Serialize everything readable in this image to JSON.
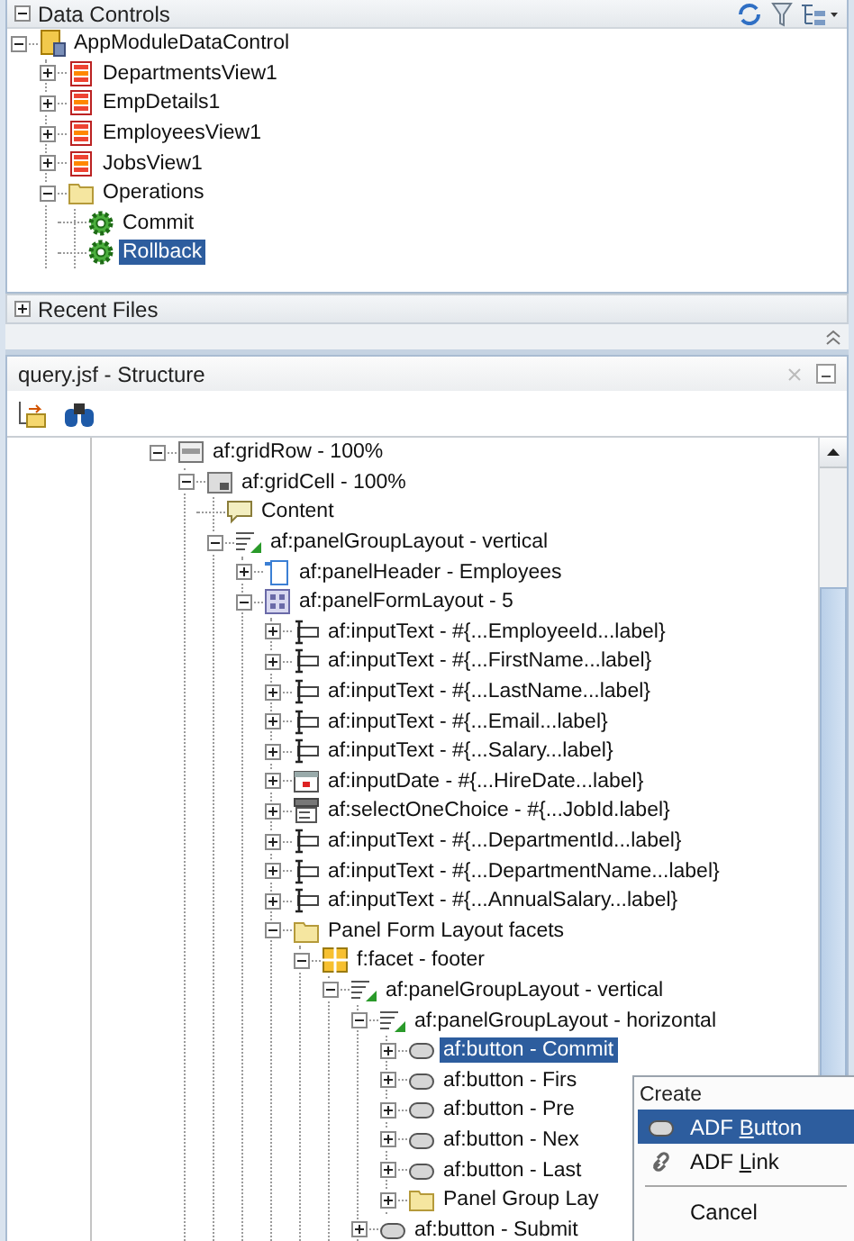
{
  "data_controls": {
    "title": "Data Controls",
    "expanded": true,
    "tree": [
      {
        "label": "AppModuleDataControl",
        "kind": "datacontrol",
        "expanded": true,
        "selected": false,
        "children": [
          {
            "label": "DepartmentsView1",
            "kind": "collection",
            "expanded": false,
            "selected": false
          },
          {
            "label": "EmpDetails1",
            "kind": "collection",
            "expanded": false,
            "selected": false
          },
          {
            "label": "EmployeesView1",
            "kind": "collection",
            "expanded": false,
            "selected": false
          },
          {
            "label": "JobsView1",
            "kind": "collection",
            "expanded": false,
            "selected": false
          },
          {
            "label": "Operations",
            "kind": "folder",
            "expanded": true,
            "selected": false,
            "children": [
              {
                "label": "Commit",
                "kind": "gear",
                "selected": false
              },
              {
                "label": "Rollback",
                "kind": "gear",
                "selected": true
              }
            ]
          }
        ]
      }
    ]
  },
  "recent_files": {
    "title": "Recent Files",
    "expanded": false
  },
  "structure": {
    "title": "query.jsf - Structure",
    "tree": [
      {
        "label": "af:gridRow - 100%",
        "kind": "gridrow",
        "expanded": true,
        "selected": false,
        "children": [
          {
            "label": "af:gridCell - 100%",
            "kind": "gridcell",
            "expanded": true,
            "selected": false,
            "children": [
              {
                "label": "Content",
                "kind": "content",
                "selected": false
              },
              {
                "label": "af:panelGroupLayout - vertical",
                "kind": "pgl",
                "expanded": true,
                "selected": false,
                "children": [
                  {
                    "label": "af:panelHeader - Employees",
                    "kind": "header",
                    "expanded": false,
                    "selected": false
                  },
                  {
                    "label": "af:panelFormLayout - 5",
                    "kind": "form",
                    "expanded": true,
                    "selected": false,
                    "children": [
                      {
                        "label": "af:inputText - #{...EmployeeId...label}",
                        "kind": "input",
                        "expanded": false,
                        "selected": false
                      },
                      {
                        "label": "af:inputText - #{...FirstName...label}",
                        "kind": "input",
                        "expanded": false,
                        "selected": false
                      },
                      {
                        "label": "af:inputText - #{...LastName...label}",
                        "kind": "input",
                        "expanded": false,
                        "selected": false
                      },
                      {
                        "label": "af:inputText - #{...Email...label}",
                        "kind": "input",
                        "expanded": false,
                        "selected": false
                      },
                      {
                        "label": "af:inputText - #{...Salary...label}",
                        "kind": "input",
                        "expanded": false,
                        "selected": false
                      },
                      {
                        "label": "af:inputDate - #{...HireDate...label}",
                        "kind": "date",
                        "expanded": false,
                        "selected": false
                      },
                      {
                        "label": "af:selectOneChoice - #{...JobId.label}",
                        "kind": "select",
                        "expanded": false,
                        "selected": false
                      },
                      {
                        "label": "af:inputText - #{...DepartmentId...label}",
                        "kind": "input",
                        "expanded": false,
                        "selected": false
                      },
                      {
                        "label": "af:inputText - #{...DepartmentName...label}",
                        "kind": "input",
                        "expanded": false,
                        "selected": false
                      },
                      {
                        "label": "af:inputText - #{...AnnualSalary...label}",
                        "kind": "input",
                        "expanded": false,
                        "selected": false
                      },
                      {
                        "label": "Panel Form Layout facets",
                        "kind": "folder",
                        "expanded": true,
                        "selected": false,
                        "children": [
                          {
                            "label": "f:facet - footer",
                            "kind": "facet",
                            "expanded": true,
                            "selected": false,
                            "children": [
                              {
                                "label": "af:panelGroupLayout - vertical",
                                "kind": "pgl",
                                "expanded": true,
                                "selected": false,
                                "children": [
                                  {
                                    "label": "af:panelGroupLayout - horizontal",
                                    "kind": "pgl",
                                    "expanded": true,
                                    "selected": false,
                                    "children": [
                                      {
                                        "label": "af:button - Commit",
                                        "kind": "button",
                                        "expanded": false,
                                        "selected": true
                                      },
                                      {
                                        "label": "af:button - Firs",
                                        "kind": "button",
                                        "expanded": false,
                                        "selected": false
                                      },
                                      {
                                        "label": "af:button - Pre",
                                        "kind": "button",
                                        "expanded": false,
                                        "selected": false
                                      },
                                      {
                                        "label": "af:button - Nex",
                                        "kind": "button",
                                        "expanded": false,
                                        "selected": false
                                      },
                                      {
                                        "label": "af:button - Last",
                                        "kind": "button",
                                        "expanded": false,
                                        "selected": false
                                      },
                                      {
                                        "label": "Panel Group Lay",
                                        "kind": "folder",
                                        "expanded": false,
                                        "selected": false
                                      }
                                    ]
                                  },
                                  {
                                    "label": "af:button - Submit",
                                    "kind": "button",
                                    "expanded": false,
                                    "selected": false
                                  }
                                ]
                              }
                            ]
                          }
                        ]
                      }
                    ]
                  }
                ]
              }
            ]
          }
        ]
      }
    ]
  },
  "context_menu": {
    "header": "Create",
    "items": [
      {
        "kind": "button",
        "label_parts": [
          "ADF ",
          "B",
          "utton"
        ],
        "selected": true
      },
      {
        "kind": "link",
        "label_parts": [
          "ADF ",
          "L",
          "ink"
        ],
        "selected": false
      },
      {
        "kind": "separator"
      },
      {
        "kind": "plain",
        "label_parts": [
          "Cancel"
        ],
        "selected": false
      }
    ]
  }
}
